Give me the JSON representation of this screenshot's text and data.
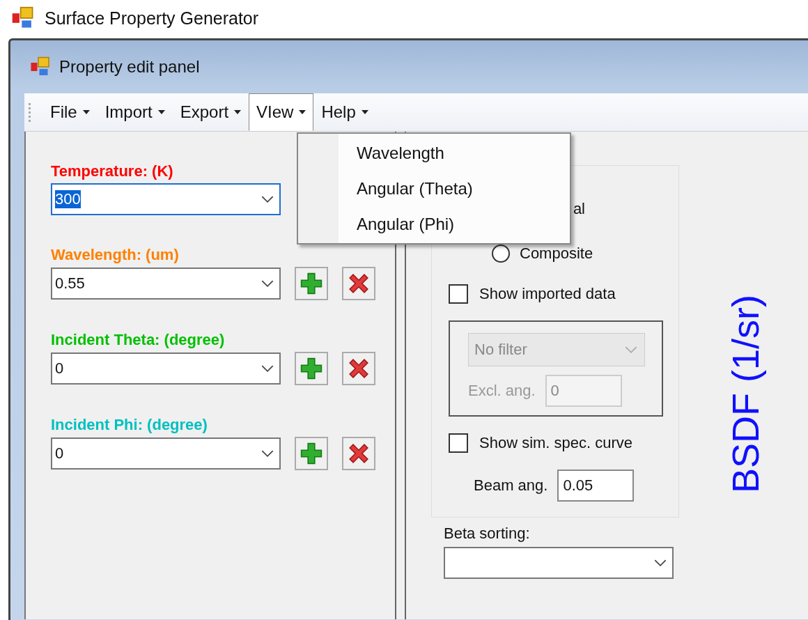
{
  "app_title": "Surface Property Generator",
  "panel_title": "Property edit panel",
  "menu": [
    {
      "label": "File",
      "selected": false
    },
    {
      "label": "Import",
      "selected": false
    },
    {
      "label": "Export",
      "selected": false
    },
    {
      "label": "VIew",
      "selected": true
    },
    {
      "label": "Help",
      "selected": false
    }
  ],
  "open_menu": {
    "items": [
      "Wavelength",
      "Angular (Theta)",
      "Angular (Phi)"
    ]
  },
  "parameters": [
    {
      "label": "Temperature: (K)",
      "color": "#ff0000",
      "value": "300",
      "focused": true,
      "buttons": false
    },
    {
      "label": "Wavelength: (um)",
      "color": "#ff8000",
      "value": "0.55",
      "focused": false,
      "buttons": true
    },
    {
      "label": "Incident Theta: (degree)",
      "color": "#00c000",
      "value": "0",
      "focused": false,
      "buttons": true
    },
    {
      "label": "Incident Phi: (degree)",
      "color": "#00c0c0",
      "value": "0",
      "focused": false,
      "buttons": true
    }
  ],
  "display": {
    "radios": [
      {
        "label": "al"
      },
      {
        "label": "Composite",
        "selected": false
      }
    ],
    "show_imported": {
      "label": "Show imported data",
      "checked": false
    },
    "filter": {
      "value": "No filter",
      "disabled": true
    },
    "excl": {
      "label": "Excl. ang.",
      "value": "0",
      "disabled": true
    },
    "show_sim": {
      "label": "Show sim. spec. curve",
      "checked": false
    },
    "beam": {
      "label": "Beam ang.",
      "value": "0.05"
    }
  },
  "beta_sorting": {
    "label": "Beta sorting:"
  },
  "axis_label": "BSDF (1/sr)"
}
